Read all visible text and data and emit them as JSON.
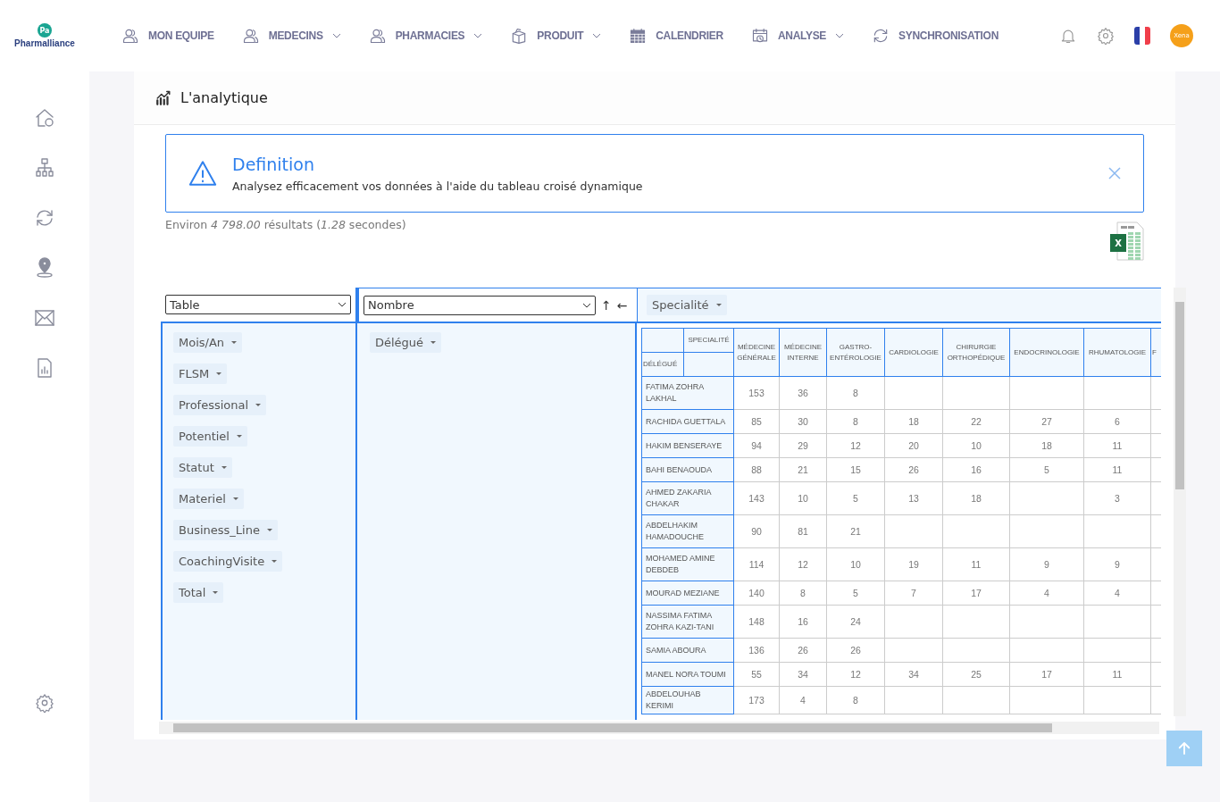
{
  "logo": {
    "mark": "Pa",
    "name": "Pharmalliance"
  },
  "nav": [
    {
      "label": "MON EQUIPE",
      "dropdown": false
    },
    {
      "label": "MEDECINS",
      "dropdown": true
    },
    {
      "label": "PHARMACIES",
      "dropdown": true
    },
    {
      "label": "PRODUIT",
      "dropdown": true
    },
    {
      "label": "CALENDRIER",
      "dropdown": false
    },
    {
      "label": "ANALYSE",
      "dropdown": true
    },
    {
      "label": "SYNCHRONISATION",
      "dropdown": false
    }
  ],
  "avatar": {
    "label": "Xena"
  },
  "page_title": "L'analytique",
  "alert": {
    "title": "Definition",
    "text": "Analysez efficacement vos données à l'aide du tableau croisé dynamique"
  },
  "results": "Environ *4 798.00* résultats (*1.28* secondes)",
  "export": {
    "label": "X"
  },
  "pivot": {
    "renderer": "Table",
    "aggregator": "Nombre",
    "sort_arrows": [
      "↑",
      "←"
    ],
    "col_attrs": [
      "Specialité"
    ],
    "unused_attrs": [
      "Mois/An",
      "FLSM",
      "Professional",
      "Potentiel",
      "Statut",
      "Materiel",
      "Business_Line",
      "CoachingVisite",
      "Total"
    ],
    "row_attrs": [
      "Délégué"
    ],
    "table": {
      "col_axis": "SPECIALITÉ",
      "row_axis": "DÉLÉGUÉ",
      "columns": [
        "MÉDECINE GÉNÉRALE",
        "MÉDECINE INTERNE",
        "GASTRO-ENTÉROLOGIE",
        "CARDIOLOGIE",
        "CHIRURGIE ORTHOPÉDIQUE",
        "ENDOCRINOLOGIE",
        "RHUMATOLOGIE",
        "F"
      ],
      "rows": [
        {
          "name": "FATIMA ZOHRA LAKHAL",
          "column_1": "153",
          "column_2": "36",
          "column_3": "8"
        },
        {
          "name": "RACHIDA GUETTALA",
          "column_1": "85",
          "column_2": "30",
          "column_3": "8",
          "column_4": "18",
          "column_5": "22",
          "column_6": "27",
          "column_7": "6"
        },
        {
          "name": "HAKIM BENSERAYE",
          "column_1": "94",
          "column_2": "29",
          "column_3": "12",
          "column_4": "20",
          "column_5": "10",
          "column_6": "18",
          "column_7": "11"
        },
        {
          "name": "BAHI BENAOUDA",
          "column_1": "88",
          "column_2": "21",
          "column_3": "15",
          "column_4": "26",
          "column_5": "16",
          "column_6": "5",
          "column_7": "11"
        },
        {
          "name": "AHMED ZAKARIA CHAKAR",
          "column_1": "143",
          "column_2": "10",
          "column_3": "5",
          "column_4": "13",
          "column_5": "18",
          "column_7": "3"
        },
        {
          "name": "ABDELHAKIM HAMADOUCHE",
          "column_1": "90",
          "column_2": "81",
          "column_3": "21"
        },
        {
          "name": "MOHAMED AMINE DEBDEB",
          "column_1": "114",
          "column_2": "12",
          "column_3": "10",
          "column_4": "19",
          "column_5": "11",
          "column_6": "9",
          "column_7": "9"
        },
        {
          "name": "MOURAD MEZIANE",
          "column_1": "140",
          "column_2": "8",
          "column_3": "5",
          "column_4": "7",
          "column_5": "17",
          "column_6": "4",
          "column_7": "4"
        },
        {
          "name": "NASSIMA FATIMA ZOHRA KAZI-TANI",
          "column_1": "148",
          "column_2": "16",
          "column_3": "24"
        },
        {
          "name": "SAMIA ABOURA",
          "column_1": "136",
          "column_2": "26",
          "column_3": "26"
        },
        {
          "name": "MANEL NORA TOUMI",
          "column_1": "55",
          "column_2": "34",
          "column_3": "12",
          "column_4": "34",
          "column_5": "25",
          "column_6": "17",
          "column_7": "11"
        },
        {
          "name": "ABDELOUHAB KERIMI",
          "column_1": "173",
          "column_2": "4",
          "column_3": "8"
        }
      ]
    }
  }
}
